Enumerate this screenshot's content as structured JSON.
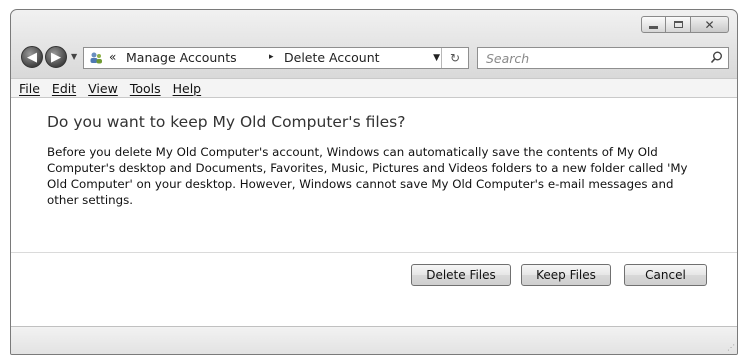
{
  "window": {
    "caption_buttons": {
      "minimize_icon": "minimize-icon",
      "maximize_icon": "maximize-icon",
      "close_icon": "close-icon"
    }
  },
  "nav": {
    "address": {
      "chevron": "«",
      "crumb1": "Manage Accounts",
      "separator": "▸",
      "crumb2": "Delete Account"
    },
    "search": {
      "placeholder": "Search"
    }
  },
  "menu": {
    "items": [
      {
        "label": "File"
      },
      {
        "label": "Edit"
      },
      {
        "label": "View"
      },
      {
        "label": "Tools"
      },
      {
        "label": "Help"
      }
    ]
  },
  "dialog": {
    "heading": "Do you want to keep My Old Computer's files?",
    "body": "Before you delete My Old Computer's account, Windows can automatically save the contents of My Old Computer's desktop and Documents, Favorites, Music, Pictures and Videos folders to a new folder called 'My Old Computer' on your desktop. However, Windows cannot save My Old Computer's e-mail messages and other settings.",
    "buttons": {
      "delete": "Delete Files",
      "keep": "Keep Files",
      "cancel": "Cancel"
    }
  }
}
